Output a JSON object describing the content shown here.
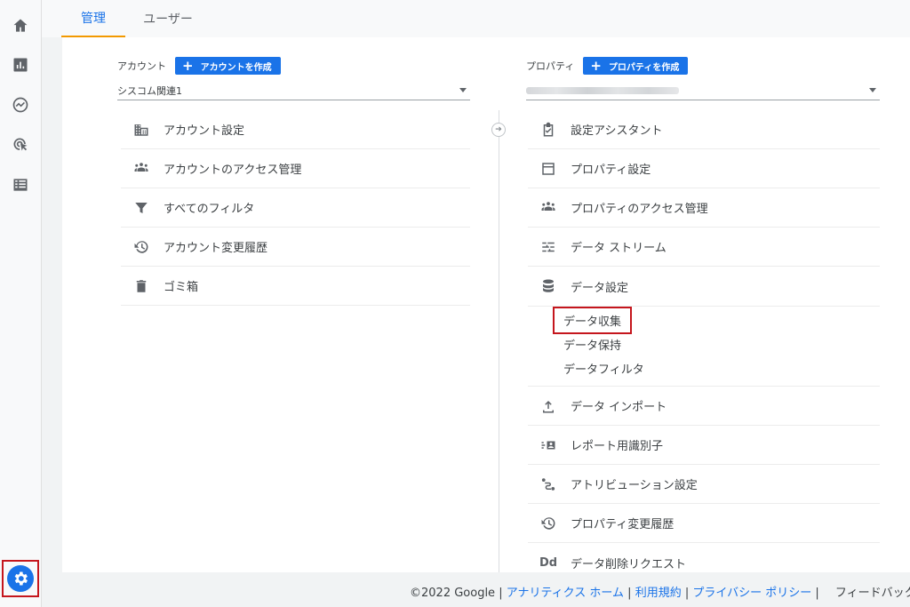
{
  "tabs": {
    "admin": "管理",
    "user": "ユーザー"
  },
  "account": {
    "label": "アカウント",
    "create_button": "アカウントを作成",
    "selected": "シスコム関連1",
    "menu": [
      {
        "label": "アカウント設定",
        "icon": "building-icon"
      },
      {
        "label": "アカウントのアクセス管理",
        "icon": "people-icon"
      },
      {
        "label": "すべてのフィルタ",
        "icon": "filter-icon"
      },
      {
        "label": "アカウント変更履歴",
        "icon": "history-icon"
      },
      {
        "label": "ゴミ箱",
        "icon": "trash-icon"
      }
    ]
  },
  "property": {
    "label": "プロパティ",
    "create_button": "プロパティを作成",
    "menu": [
      {
        "label": "設定アシスタント",
        "icon": "checklist-icon"
      },
      {
        "label": "プロパティ設定",
        "icon": "layout-icon"
      },
      {
        "label": "プロパティのアクセス管理",
        "icon": "people-icon"
      },
      {
        "label": "データ ストリーム",
        "icon": "stream-icon"
      },
      {
        "label": "データ設定",
        "icon": "database-icon"
      }
    ],
    "data_settings_sub": [
      {
        "label": "データ収集"
      },
      {
        "label": "データ保持"
      },
      {
        "label": "データフィルタ"
      }
    ],
    "menu_after": [
      {
        "label": "データ インポート",
        "icon": "upload-icon"
      },
      {
        "label": "レポート用識別子",
        "icon": "identity-icon"
      },
      {
        "label": "アトリビューション設定",
        "icon": "attribution-icon"
      },
      {
        "label": "プロパティ変更履歴",
        "icon": "history-icon"
      },
      {
        "label": "データ削除リクエスト",
        "icon": "dd-icon"
      }
    ]
  },
  "footer": {
    "copyright": "©2022 Google | ",
    "analytics_home": "アナリティクス ホーム",
    "terms": "利用規約",
    "privacy": "プライバシー ポリシー",
    "feedback": "フィードバック",
    "sep": " | "
  }
}
